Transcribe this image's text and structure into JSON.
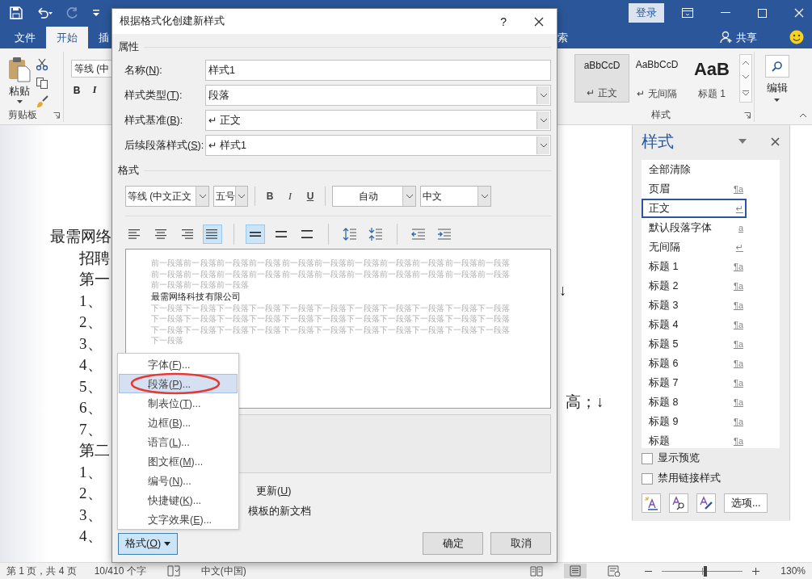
{
  "word": {
    "sign_in": "登录",
    "tabs": [
      {
        "label": "文件",
        "selected": false
      },
      {
        "label": "开始",
        "selected": true
      },
      {
        "label": "插",
        "selected": false
      }
    ],
    "tell_me": "索",
    "share": "共享",
    "ribbon": {
      "paste": "粘贴",
      "clipboard_label": "剪贴板",
      "font_name": "等线 (中",
      "bold": "B",
      "italic": "I",
      "gallery": [
        {
          "preview": "aBbCcD",
          "name": "↵ 正文",
          "selected": true
        },
        {
          "preview": "AaBbCcD",
          "name": "↵ 无间隔",
          "selected": false
        },
        {
          "preview": "AaB",
          "name": "标题 1",
          "selected": false
        }
      ],
      "styles_label": "样式",
      "editing": "编辑"
    },
    "document": {
      "lines": [
        "最需网络",
        "招聘",
        "第一",
        "1、",
        "2、",
        "3、",
        "4、",
        "5、",
        "6、",
        "7、",
        "第二",
        "1、",
        "2、",
        "3、",
        "4、"
      ],
      "right_marks": [
        "↓",
        "高；↓"
      ]
    },
    "status_bar": {
      "page": "第 1 页，共 4 页",
      "words": "10/410 个字",
      "language": "中文(中国)",
      "zoom": "130%",
      "level": 0.54
    }
  },
  "dialog": {
    "title": "根据格式化创建新样式",
    "help": "?",
    "properties_heading": "属性",
    "fields": [
      {
        "label": "名称(N):",
        "value": "样式1",
        "kind": "text"
      },
      {
        "label": "样式类型(T):",
        "value": "段落",
        "kind": "select"
      },
      {
        "label": "样式基准(B):",
        "value": "↵ 正文",
        "kind": "select"
      },
      {
        "label": "后续段落样式(S):",
        "value": "↵ 样式1",
        "kind": "select"
      }
    ],
    "format_heading": "格式",
    "font": "等线 (中文正文",
    "size": "五号",
    "bold": "B",
    "italic": "I",
    "underline": "U",
    "font_color": "自动",
    "language": "中文",
    "align_buttons": [
      {
        "kind": "left",
        "selected": false
      },
      {
        "kind": "center",
        "selected": false
      },
      {
        "kind": "right",
        "selected": false
      },
      {
        "kind": "justify",
        "selected": true
      }
    ],
    "spacing_buttons": [
      {
        "kind": "single",
        "selected": true
      },
      {
        "kind": "onehalf",
        "selected": false
      },
      {
        "kind": "double",
        "selected": false
      }
    ],
    "preview": {
      "before": [
        "前一段落前一段落前一段落前一段落前一段落前一段落前一段落前一段落前一段落前一段落前一段落",
        "前一段落前一段落前一段落前一段落前一段落前一段落前一段落前一段落前一段落前一段落前一段落",
        "前一段落前一段落前一段落"
      ],
      "sample": "最需网络科技有限公司",
      "after": [
        "下一段落下一段落下一段落下一段落下一段落下一段落下一段落下一段落下一段落下一段落下一段落",
        "下一段落下一段落下一段落下一段落下一段落下一段落下一段落下一段落下一段落下一段落下一段落",
        "下一段落下一段落下一段落下一段落下一段落下一段落下一段落下一段落下一段落下一段落下一段落",
        "下一段落"
      ]
    },
    "option_texts": [
      "更新(U)",
      "模板的新文档"
    ],
    "format_button": "格式(O)",
    "ok": "确定",
    "cancel": "取消",
    "menu": [
      {
        "label": "字体(F)...",
        "selected": false
      },
      {
        "label": "段落(P)...",
        "selected": true
      },
      {
        "label": "制表位(T)...",
        "selected": false
      },
      {
        "label": "边框(B)...",
        "selected": false
      },
      {
        "label": "语言(L)...",
        "selected": false
      },
      {
        "label": "图文框(M)...",
        "selected": false
      },
      {
        "label": "编号(N)...",
        "selected": false
      },
      {
        "label": "快捷键(K)...",
        "selected": false
      },
      {
        "label": "文字效果(E)...",
        "selected": false
      }
    ]
  },
  "styles_pane": {
    "title": "样式",
    "items": [
      {
        "name": "全部清除",
        "selected": false
      },
      {
        "name": "页眉",
        "mark": "¶a",
        "selected": false
      },
      {
        "name": "正文",
        "mark": "↵",
        "selected": true
      },
      {
        "name": "默认段落字体",
        "mark": "a",
        "selected": false
      },
      {
        "name": "无间隔",
        "mark": "↵",
        "selected": false
      },
      {
        "name": "标题 1",
        "mark": "¶a",
        "selected": false
      },
      {
        "name": "标题 2",
        "mark": "¶a",
        "selected": false
      },
      {
        "name": "标题 3",
        "mark": "¶a",
        "selected": false
      },
      {
        "name": "标题 4",
        "mark": "¶a",
        "selected": false
      },
      {
        "name": "标题 5",
        "mark": "¶a",
        "selected": false
      },
      {
        "name": "标题 6",
        "mark": "¶a",
        "selected": false
      },
      {
        "name": "标题 7",
        "mark": "¶a",
        "selected": false
      },
      {
        "name": "标题 8",
        "mark": "¶a",
        "selected": false
      },
      {
        "name": "标题 9",
        "mark": "¶a",
        "selected": false
      },
      {
        "name": "标题",
        "mark": "¶a",
        "selected": false
      }
    ],
    "options": [
      {
        "label": "显示预览",
        "checked": false
      },
      {
        "label": "禁用链接样式",
        "checked": false
      }
    ],
    "options_button": "选项..."
  }
}
